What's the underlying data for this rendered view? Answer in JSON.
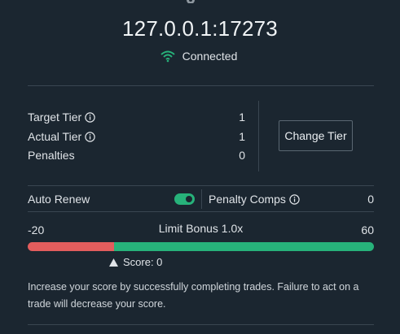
{
  "header": {
    "address": "127.0.0.1:17273",
    "status": "Connected",
    "status_color": "#27b27a"
  },
  "tier": {
    "target_label": "Target Tier",
    "target_value": "1",
    "actual_label": "Actual Tier",
    "actual_value": "1",
    "penalties_label": "Penalties",
    "penalties_value": "0",
    "change_tier_label": "Change Tier"
  },
  "settings": {
    "auto_renew_label": "Auto Renew",
    "auto_renew_on": true,
    "penalty_comps_label": "Penalty Comps",
    "penalty_comps_value": "0"
  },
  "score": {
    "min_label": "-20",
    "max_label": "60",
    "min": -20,
    "max": 60,
    "limit_bonus_label": "Limit Bonus 1.0x",
    "score_label": "Score: 0",
    "score": 0,
    "negative_color": "#e35d5d",
    "positive_color": "#27b27a",
    "hint": "Increase your score by successfully completing trades. Failure to act on a trade will decrease your score."
  },
  "icons": {
    "settings": "gear-icon",
    "wifi": "wifi-icon",
    "info": "info-icon",
    "score_pointer": "triangle-up-icon"
  }
}
